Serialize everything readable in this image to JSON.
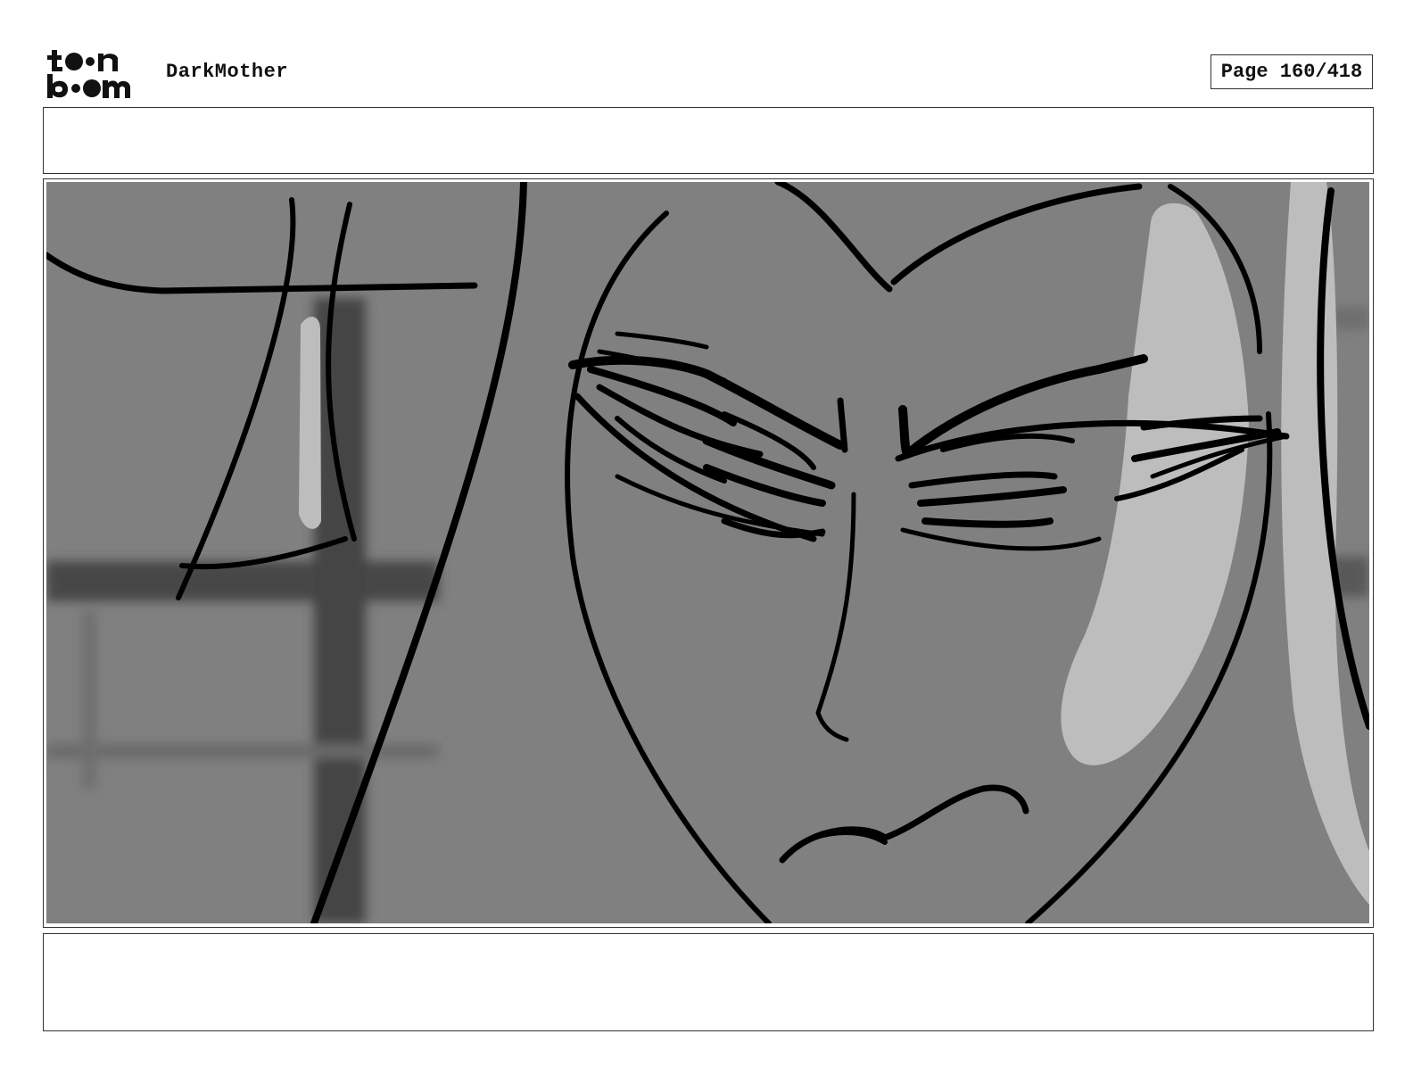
{
  "header": {
    "project_title": "DarkMother",
    "page_label": "Page 160/418"
  },
  "top_notes": {
    "text": ""
  },
  "bottom_notes": {
    "text": ""
  },
  "colors": {
    "panel_background": "#808080",
    "shadow": "#444444",
    "highlight": "#bdbdbd",
    "ink": "#000000"
  },
  "icons": {
    "logo": "toonboom-logo"
  }
}
